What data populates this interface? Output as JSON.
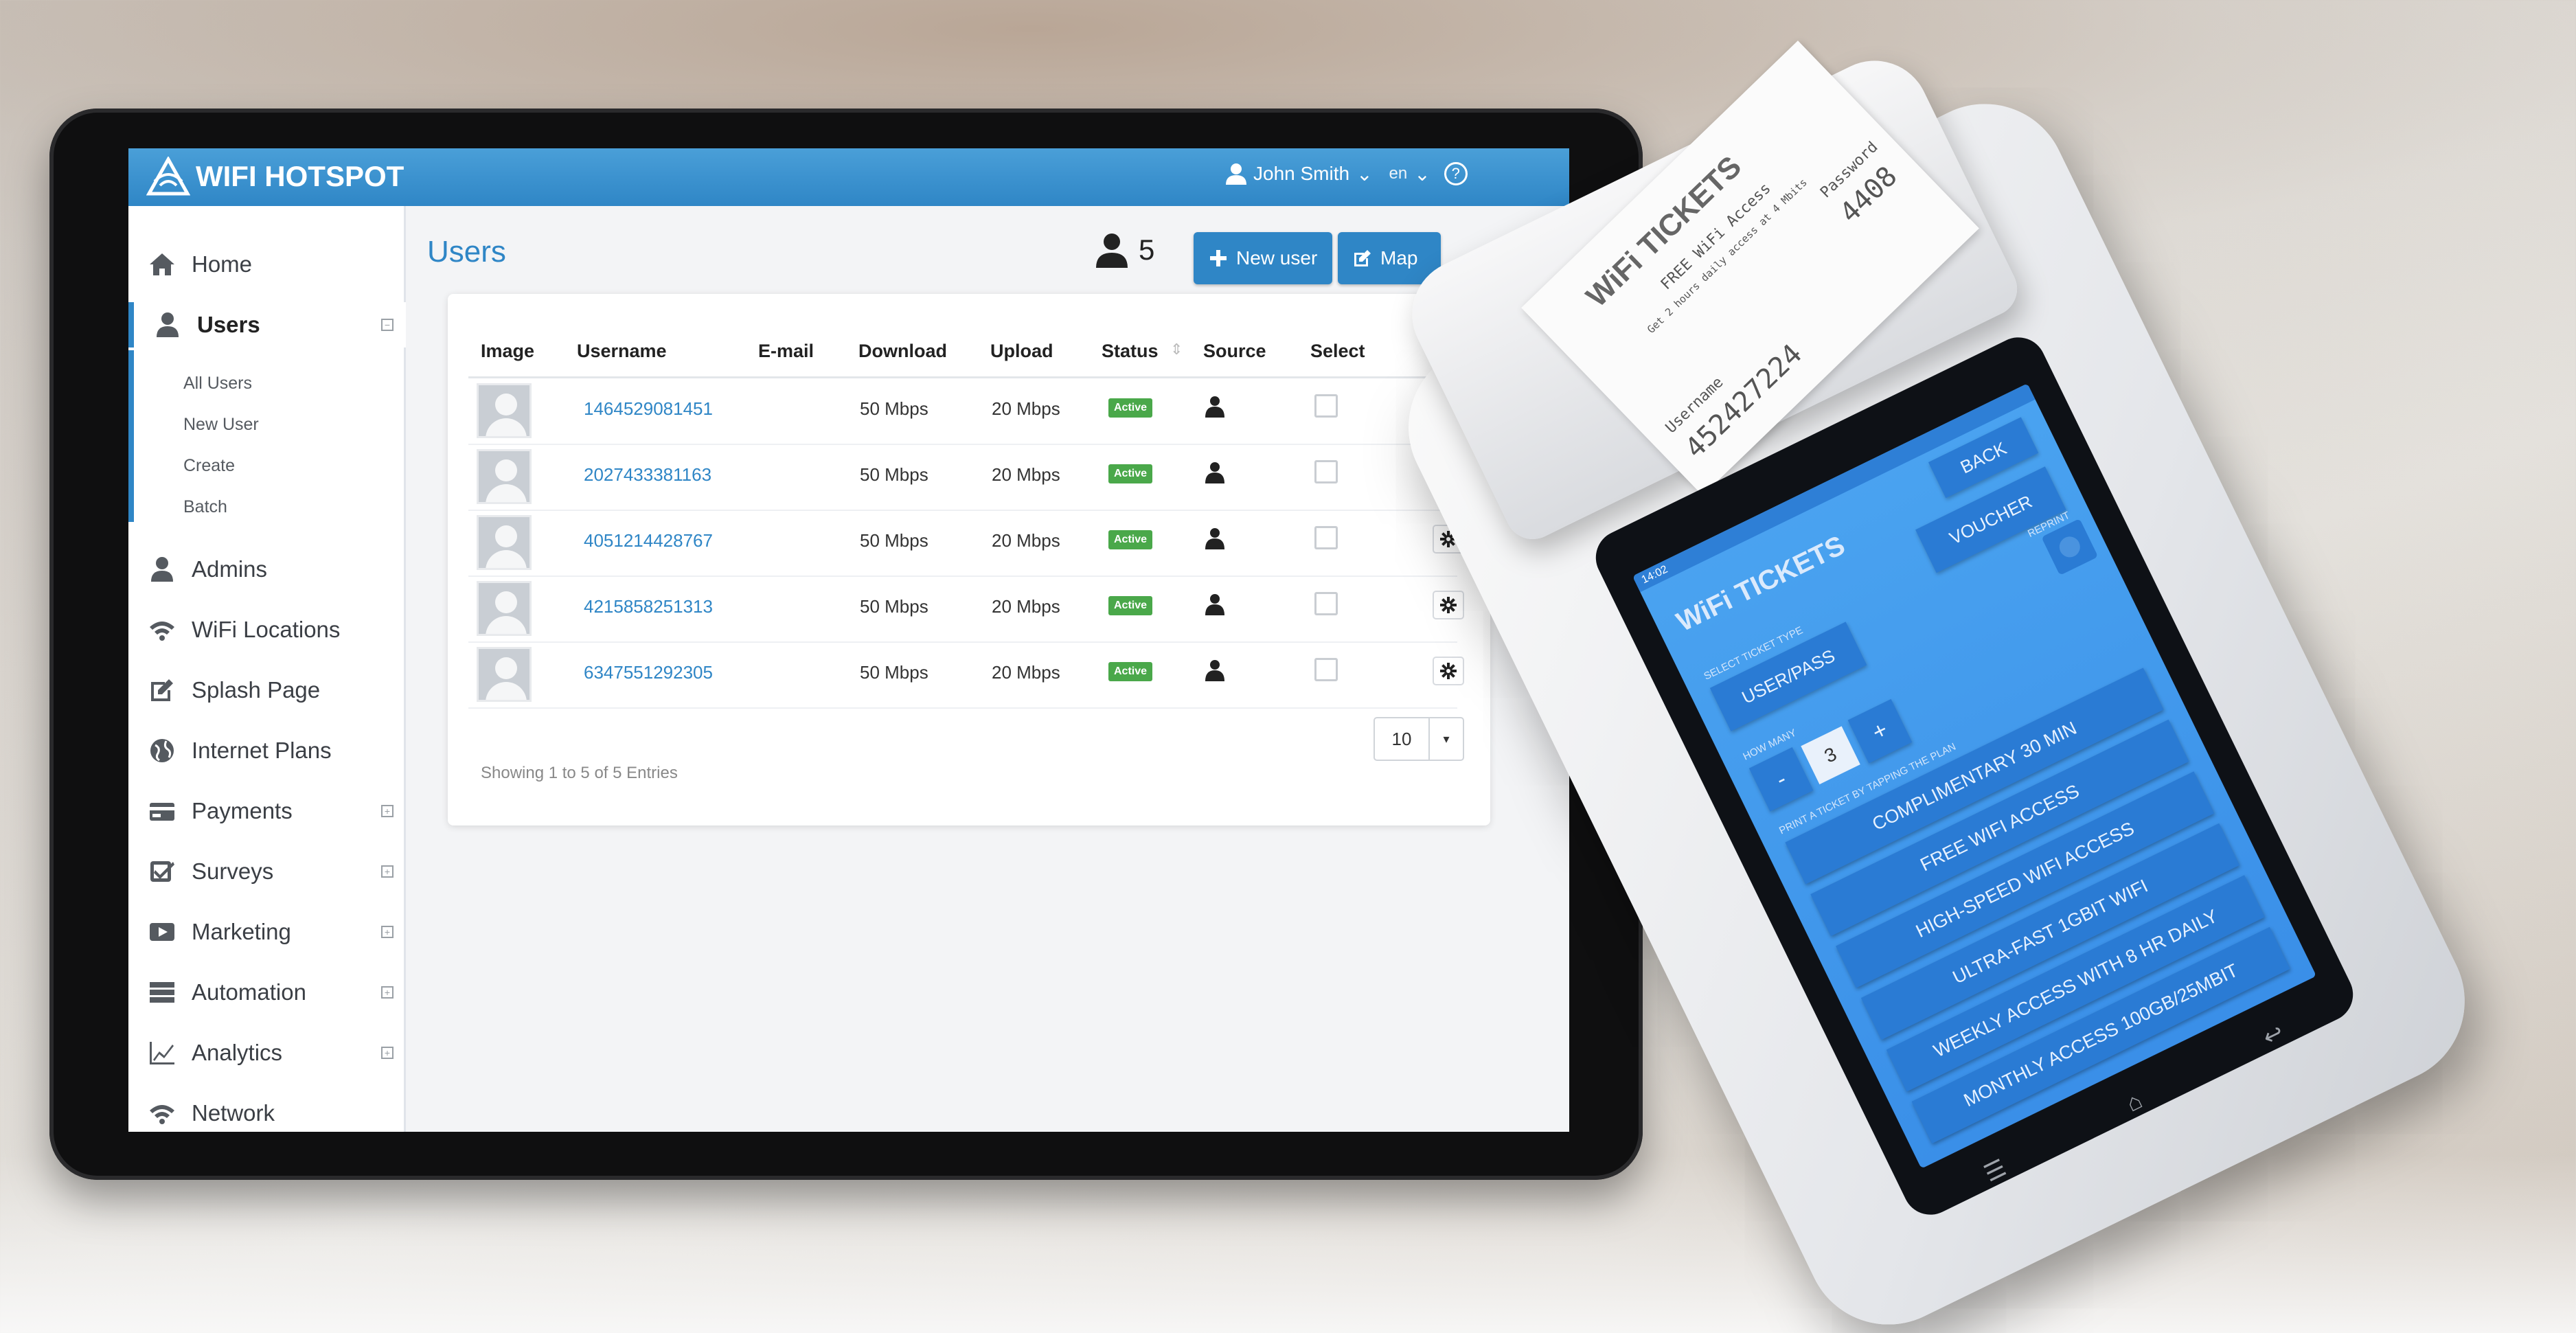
{
  "admin": {
    "brand": "WIFI HOTSPOT",
    "user_name": "John Smith",
    "language": "en",
    "help_icon": "?",
    "sidebar": {
      "items": [
        {
          "label": "Home",
          "icon": "home-icon"
        },
        {
          "label": "Users",
          "icon": "user-icon"
        },
        {
          "label": "Admins",
          "icon": "admin-icon"
        },
        {
          "label": "WiFi Locations",
          "icon": "wifi-icon"
        },
        {
          "label": "Splash Page",
          "icon": "edit-icon"
        },
        {
          "label": "Internet Plans",
          "icon": "globe-icon"
        },
        {
          "label": "Payments",
          "icon": "card-icon"
        },
        {
          "label": "Surveys",
          "icon": "checkbox-icon"
        },
        {
          "label": "Marketing",
          "icon": "play-icon"
        },
        {
          "label": "Automation",
          "icon": "server-icon"
        },
        {
          "label": "Analytics",
          "icon": "chart-icon"
        },
        {
          "label": "Network",
          "icon": "wifi-icon"
        }
      ],
      "users_submenu": [
        "All Users",
        "New User",
        "Create",
        "Batch"
      ]
    },
    "page_title": "Users",
    "user_count": "5",
    "buttons": {
      "new_user": "New user",
      "map": "Map"
    },
    "table": {
      "headers": [
        "Image",
        "Username",
        "E-mail",
        "Download",
        "Upload",
        "Status",
        "Source",
        "Select"
      ],
      "rows": [
        {
          "username": "1464529081451",
          "email": "",
          "download": "50 Mbps",
          "upload": "20 Mbps",
          "status": "Active"
        },
        {
          "username": "2027433381163",
          "email": "",
          "download": "50 Mbps",
          "upload": "20 Mbps",
          "status": "Active"
        },
        {
          "username": "4051214428767",
          "email": "",
          "download": "50 Mbps",
          "upload": "20 Mbps",
          "status": "Active"
        },
        {
          "username": "4215858251313",
          "email": "",
          "download": "50 Mbps",
          "upload": "20 Mbps",
          "status": "Active"
        },
        {
          "username": "6347551292305",
          "email": "",
          "download": "50 Mbps",
          "upload": "20 Mbps",
          "status": "Active"
        }
      ],
      "footer": "Showing 1 to 5 of 5 Entries",
      "page_size": "10"
    },
    "colors": {
      "accent": "#2f86c6",
      "status_active": "#4aa84a"
    }
  },
  "receipt": {
    "title": "WiFi TICKETS",
    "subtitle": "FREE WiFi Access",
    "note": "Get 2 hours daily access at 4 Mbits",
    "password_label": "Password",
    "password": "4408",
    "username_label": "Username",
    "username": "452427224"
  },
  "pos_app": {
    "time": "14:02",
    "back": "BACK",
    "title": "WiFi TICKETS",
    "voucher": "VOUCHER",
    "select_type_label": "SELECT TICKET TYPE",
    "reprint_label": "REPRINT",
    "user_pass": "USER/PASS",
    "how_many_label": "HOW MANY",
    "minus": "-",
    "quantity": "3",
    "plus": "+",
    "print_label": "PRINT A TICKET BY TAPPING THE PLAN",
    "plans": [
      "COMPLIMENTARY 30 MIN",
      "FREE WIFI ACCESS",
      "HIGH-SPEED WIFI ACCESS",
      "ULTRA-FAST 1GBIT WIFI",
      "WEEKLY ACCESS WITH 8 HR DAILY",
      "MONTHLY ACCESS 100GB/25MBIT"
    ]
  }
}
